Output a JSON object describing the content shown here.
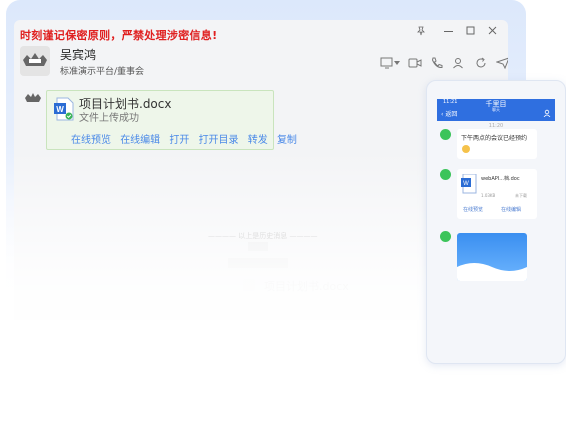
{
  "warning": "时刻谨记保密原则，严禁处理涉密信息!",
  "contact": {
    "name": "吴宾鸿",
    "org": "标准演示平台/董事会"
  },
  "file_message": {
    "file_name": "项目计划书.docx",
    "status": "文件上传成功",
    "actions": [
      "在线预览",
      "在线编辑",
      "打开",
      "打开目录",
      "转发",
      "复制"
    ]
  },
  "history_divider": "以上是历史消息",
  "faint_file_name": "项目计划书.docx",
  "phone": {
    "status_time": "11:21",
    "back": "返回",
    "title": "千里目",
    "subtitle": "聊天",
    "chat_time": "11:20",
    "message_text": "下午两点的会议已经预约",
    "file_name": "webAPI...档.doc",
    "file_size": "1.03KB",
    "file_state": "未下载",
    "preview_btn": "在线预览",
    "edit_btn": "在线编辑"
  },
  "colors": {
    "warning": "#e02020",
    "link": "#4a89e8",
    "card_bg": "#eef6ea",
    "phone_accent": "#2f6fe0",
    "online": "#3cc45a"
  }
}
